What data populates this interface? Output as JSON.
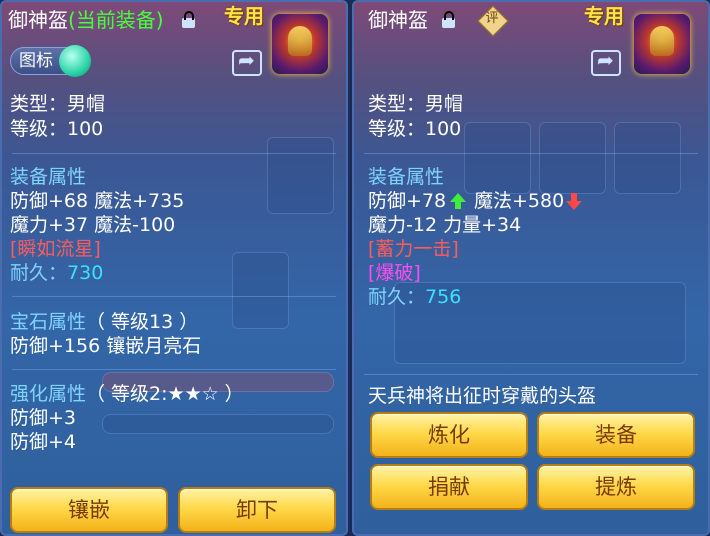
{
  "left": {
    "name": "御神盔",
    "status": "(当前装备)",
    "exclusive": "专用",
    "icon_toggle": "图标",
    "type": "类型：男帽",
    "level": "等级：100",
    "attr_header": "装备属性",
    "attr_line1": "防御+68 魔法+735",
    "attr_line2": "魔力+37 魔法-100",
    "special": "[瞬如流星]",
    "durability_label": "耐久：",
    "durability_value": "730",
    "gem_header": "宝石属性",
    "gem_level": "（ 等级13 ）",
    "gem_line": "防御+156 镶嵌月亮石",
    "enhance_header": "强化属性",
    "enhance_level": "（ 等级2:★★☆ ）",
    "enhance_line1": "防御+3",
    "enhance_line2": "防御+4",
    "btn_inlay": "镶嵌",
    "btn_unequip": "卸下"
  },
  "right": {
    "name": "御神盔",
    "rate_badge": "评",
    "exclusive": "专用",
    "type": "类型：男帽",
    "level": "等级：100",
    "attr_header": "装备属性",
    "attr_def": "防御+78",
    "attr_magic": "魔法+580",
    "attr_line2": "魔力-12 力量+34",
    "special1": "[蓄力一击]",
    "special2": "[爆破]",
    "durability_label": "耐久：",
    "durability_value": "756",
    "description": "天兵神将出征时穿戴的头盔",
    "btn_refine": "炼化",
    "btn_equip": "装备",
    "btn_donate": "捐献",
    "btn_extract": "提炼"
  },
  "colors": {
    "gold_button": "#ffd94a",
    "section_blue": "#7fd3ff",
    "status_green": "#48ff3c",
    "special_red": "#ff5b5b",
    "durability_cyan": "#39e2ff",
    "special_pink": "#ff4cf0"
  },
  "icons": [
    "lock-icon",
    "unlock-icon",
    "share-icon",
    "helmet-icon",
    "up-arrow-icon",
    "down-arrow-icon",
    "rate-badge-icon"
  ]
}
